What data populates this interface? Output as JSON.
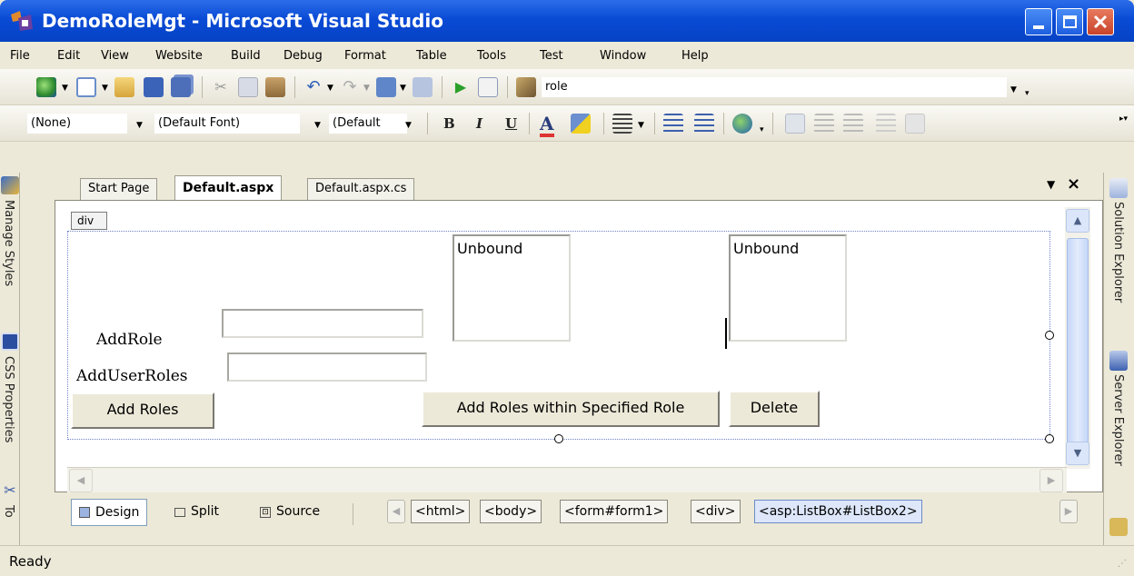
{
  "window": {
    "title": "DemoRoleMgt - Microsoft Visual Studio"
  },
  "menu": [
    "File",
    "Edit",
    "View",
    "Website",
    "Build",
    "Debug",
    "Format",
    "Table",
    "Tools",
    "Test",
    "Window",
    "Help"
  ],
  "toolbar": {
    "find_value": "role"
  },
  "format_toolbar": {
    "block_format": "(None)",
    "font_name": "(Default Font)",
    "font_size": "(Default",
    "bold": "B",
    "italic": "I",
    "underline": "U",
    "fore_color": "A"
  },
  "left_panels": [
    "Manage Styles",
    "CSS Properties",
    "To"
  ],
  "right_panels": [
    "Solution Explorer",
    "Server Explorer"
  ],
  "tabs": [
    "Start Page",
    "Default.aspx",
    "Default.aspx.cs"
  ],
  "design": {
    "div_tag": "div",
    "add_role_label": "AddRole",
    "add_user_roles_label": "AddUserRoles",
    "listbox1": "Unbound",
    "listbox2": "Unbound",
    "add_roles_button": "Add Roles",
    "add_roles_within_button": "Add Roles within Specified Role",
    "delete_button": "Delete"
  },
  "view_buttons": [
    "Design",
    "Split",
    "Source"
  ],
  "breadcrumbs": [
    "<html>",
    "<body>",
    "<form#form1>",
    "<div>",
    "<asp:ListBox#ListBox2>"
  ],
  "status": "Ready",
  "colors": {
    "titlebar": "#0a4bd6",
    "chrome": "#ece9d8",
    "selection": "#dde7f9"
  }
}
